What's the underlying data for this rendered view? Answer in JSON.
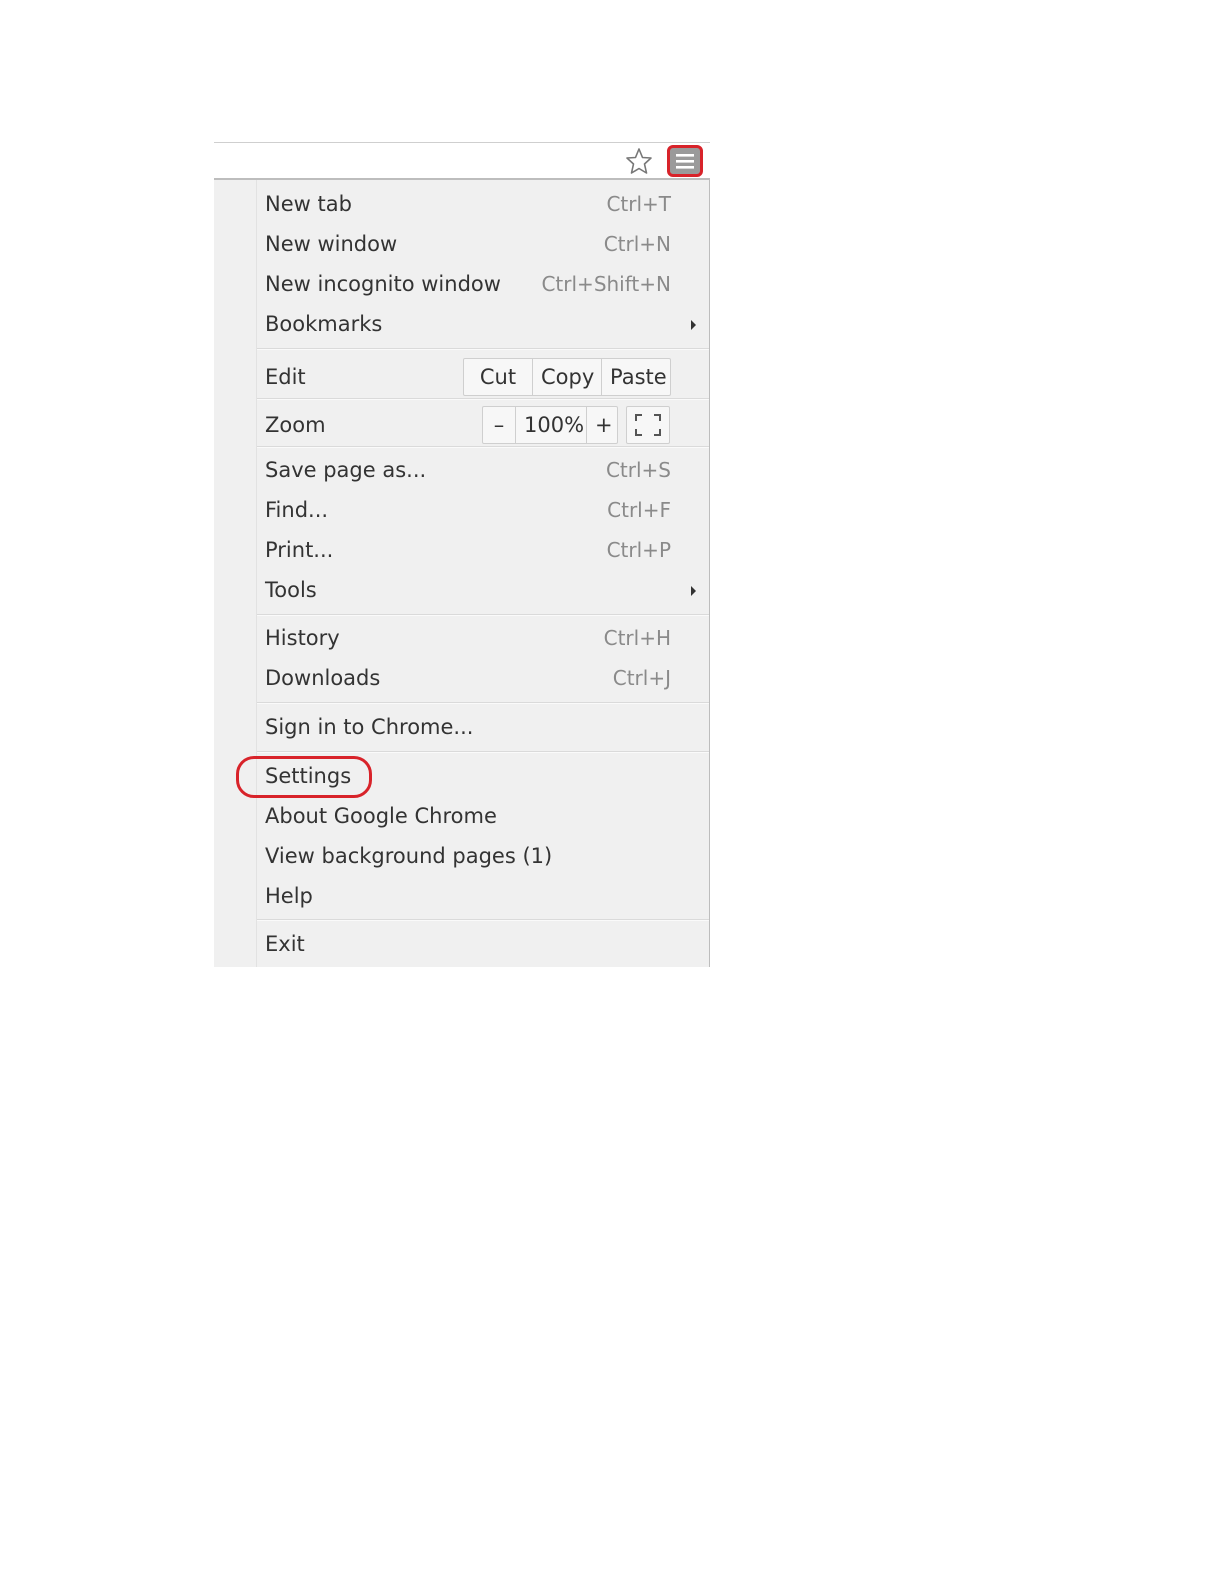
{
  "toolbar": {
    "bookmark_icon": "star-outline-icon",
    "menu_icon": "hamburger-menu-icon",
    "accent_color": "#d8232a"
  },
  "menu": {
    "new_tab": {
      "label": "New tab",
      "shortcut": "Ctrl+T"
    },
    "new_window": {
      "label": "New window",
      "shortcut": "Ctrl+N"
    },
    "new_incognito": {
      "label": "New incognito window",
      "shortcut": "Ctrl+Shift+N"
    },
    "bookmarks": {
      "label": "Bookmarks"
    },
    "edit": {
      "label": "Edit",
      "cut": "Cut",
      "copy": "Copy",
      "paste": "Paste"
    },
    "zoom": {
      "label": "Zoom",
      "minus": "–",
      "value": "100%",
      "plus": "+"
    },
    "save_page": {
      "label": "Save page as...",
      "shortcut": "Ctrl+S"
    },
    "find": {
      "label": "Find...",
      "shortcut": "Ctrl+F"
    },
    "print": {
      "label": "Print...",
      "shortcut": "Ctrl+P"
    },
    "tools": {
      "label": "Tools"
    },
    "history": {
      "label": "History",
      "shortcut": "Ctrl+H"
    },
    "downloads": {
      "label": "Downloads",
      "shortcut": "Ctrl+J"
    },
    "sign_in": {
      "label": "Sign in to Chrome..."
    },
    "settings": {
      "label": "Settings"
    },
    "about": {
      "label": "About Google Chrome"
    },
    "background_pages": {
      "label": "View background pages (1)"
    },
    "help": {
      "label": "Help"
    },
    "exit": {
      "label": "Exit"
    }
  }
}
